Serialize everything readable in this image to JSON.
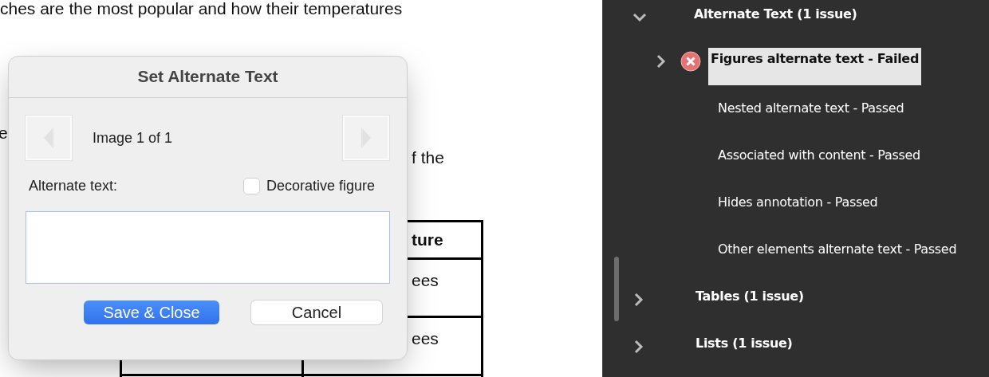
{
  "document": {
    "text_lines": [
      {
        "text": "ches are the most popular and how their temperatures"
      },
      {
        "text": "e"
      },
      {
        "text": "f the"
      }
    ],
    "table": {
      "header_cell": "ture",
      "cells": [
        "ees",
        "ees"
      ]
    }
  },
  "dialog": {
    "title": "Set Alternate Text",
    "counter": "Image 1 of 1",
    "prev_button": {
      "disabled": true
    },
    "next_button": {
      "disabled": true
    },
    "field_label": "Alternate text:",
    "decorative_checkbox": {
      "label": "Decorative figure",
      "checked": false
    },
    "buttons": [
      {
        "label": "Save & Close",
        "kind": "primary"
      },
      {
        "label": "Cancel",
        "kind": "secondary"
      }
    ]
  },
  "checker_panel": {
    "items": [
      {
        "label": "Alternate Text (1 issue)",
        "expanded": true,
        "children": [
          {
            "label": "Figures alternate text - Failed",
            "failed": true,
            "expanded": false,
            "selected": true
          },
          {
            "label": "Nested alternate text - Passed",
            "failed": false,
            "selected": false
          },
          {
            "label": "Associated with content - Passed",
            "failed": false,
            "selected": false
          },
          {
            "label": "Hides annotation - Passed",
            "failed": false,
            "selected": false
          },
          {
            "label": "Other elements alternate text - Passed",
            "failed": false,
            "selected": false
          }
        ]
      },
      {
        "label": "Tables (1 issue)",
        "expanded": false
      },
      {
        "label": "Lists (1 issue)",
        "expanded": false
      }
    ]
  }
}
